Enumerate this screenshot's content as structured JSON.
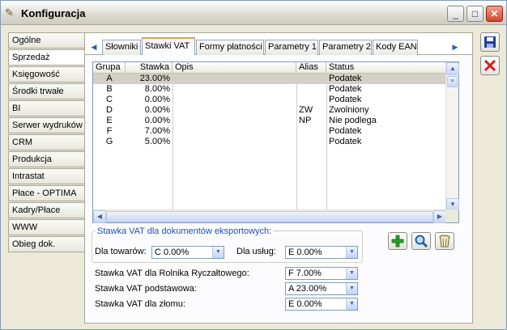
{
  "window": {
    "title": "Konfiguracja",
    "icon": "gear-pencil-icon"
  },
  "titlebar_buttons": {
    "minimize": "_",
    "maximize": "□",
    "close": "✕"
  },
  "nav": {
    "items": [
      {
        "label": "Ogólne"
      },
      {
        "label": "Sprzedaż"
      },
      {
        "label": "Księgowość"
      },
      {
        "label": "Środki trwałe"
      },
      {
        "label": "BI"
      },
      {
        "label": "Serwer wydruków"
      },
      {
        "label": "CRM"
      },
      {
        "label": "Produkcja"
      },
      {
        "label": "Intrastat"
      },
      {
        "label": "Płace - OPTIMA"
      },
      {
        "label": "Kadry/Płace"
      },
      {
        "label": "WWW"
      },
      {
        "label": "Obieg dok."
      }
    ],
    "active_index": 1
  },
  "tabs": [
    {
      "label": "Słowniki"
    },
    {
      "label": "Stawki VAT"
    },
    {
      "label": "Formy płatności"
    },
    {
      "label": "Parametry 1"
    },
    {
      "label": "Parametry 2"
    },
    {
      "label": "Kody EAN"
    }
  ],
  "active_tab": 1,
  "grid": {
    "columns": [
      "Grupa",
      "Stawka",
      "Opis",
      "Alias",
      "Status"
    ],
    "rows": [
      {
        "grupa": "A",
        "stawka": "23.00%",
        "opis": "",
        "alias": "",
        "status": "Podatek"
      },
      {
        "grupa": "B",
        "stawka": "8.00%",
        "opis": "",
        "alias": "",
        "status": "Podatek"
      },
      {
        "grupa": "C",
        "stawka": "0.00%",
        "opis": "",
        "alias": "",
        "status": "Podatek"
      },
      {
        "grupa": "D",
        "stawka": "0.00%",
        "opis": "",
        "alias": "ZW",
        "status": "Zwolniony"
      },
      {
        "grupa": "E",
        "stawka": "0.00%",
        "opis": "",
        "alias": "NP",
        "status": "Nie podlega"
      },
      {
        "grupa": "F",
        "stawka": "7.00%",
        "opis": "",
        "alias": "",
        "status": "Podatek"
      },
      {
        "grupa": "G",
        "stawka": "5.00%",
        "opis": "",
        "alias": "",
        "status": "Podatek"
      }
    ],
    "selected_row": 0
  },
  "export_group": {
    "title": "Stawka VAT dla dokumentów eksportowych:",
    "towary_label": "Dla towarów:",
    "towary_value": "C 0.00%",
    "uslugi_label": "Dla usług:",
    "uslugi_value": "E 0.00%"
  },
  "fields": {
    "rolnik_label": "Stawka VAT dla Rolnika Ryczałtowego:",
    "rolnik_value": "F 7.00%",
    "podstawowa_label": "Stawka VAT podstawowa:",
    "podstawowa_value": "A 23.00%",
    "zlom_label": "Stawka VAT dla złomu:",
    "zlom_value": "E 0.00%"
  },
  "actions": {
    "add": "add-icon",
    "preview": "magnifier-icon",
    "delete": "trash-icon"
  },
  "side_actions": {
    "save": "save-icon",
    "cancel": "cancel-icon"
  },
  "colors": {
    "accent_tab": "#e6a23c",
    "group_title": "#1e4fb5",
    "add_green": "#2e9e2e",
    "cancel_red": "#d12020",
    "save_blue": "#1f3f9a"
  }
}
